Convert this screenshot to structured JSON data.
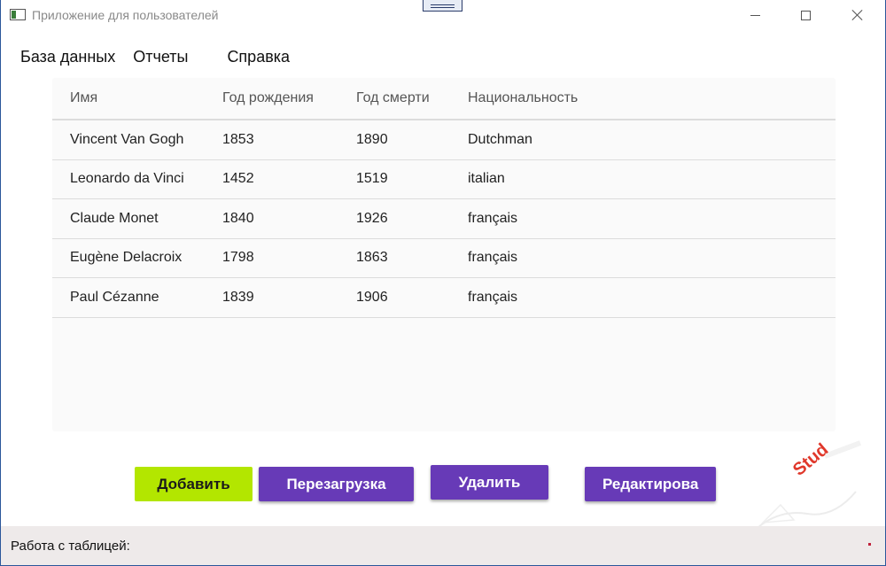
{
  "window": {
    "title": "Приложение для пользователей"
  },
  "menu": {
    "items": [
      {
        "label": "База данных"
      },
      {
        "label": "Отчеты"
      },
      {
        "label": "Справка"
      }
    ]
  },
  "table": {
    "columns": [
      "Имя",
      "Год рождения",
      "Год смерти",
      "Национальность"
    ],
    "rows": [
      [
        "Vincent Van Gogh",
        "1853",
        "1890",
        "Dutchman"
      ],
      [
        "Leonardo da Vinci",
        "1452",
        "1519",
        "italian"
      ],
      [
        "Claude Monet",
        "1840",
        "1926",
        "français"
      ],
      [
        "Eugène Delacroix",
        "1798",
        "1863",
        "français"
      ],
      [
        "Paul Cézanne",
        "1839",
        "1906",
        "français"
      ]
    ]
  },
  "buttons": {
    "add": "Добавить",
    "reload": "Перезагрузка",
    "delete": "Удалить",
    "edit": "Редактирова"
  },
  "watermark": {
    "text": "Stud"
  },
  "status": {
    "text": "Работа с таблицей:"
  },
  "colors": {
    "accent": "#673ab7",
    "add_button": "#b3e600",
    "status_bar": "#eeeaea",
    "watermark": "#e0382b"
  },
  "icons": {
    "app": "app-window-icon",
    "minimize": "minimize-icon",
    "maximize": "maximize-icon",
    "close": "close-icon"
  }
}
